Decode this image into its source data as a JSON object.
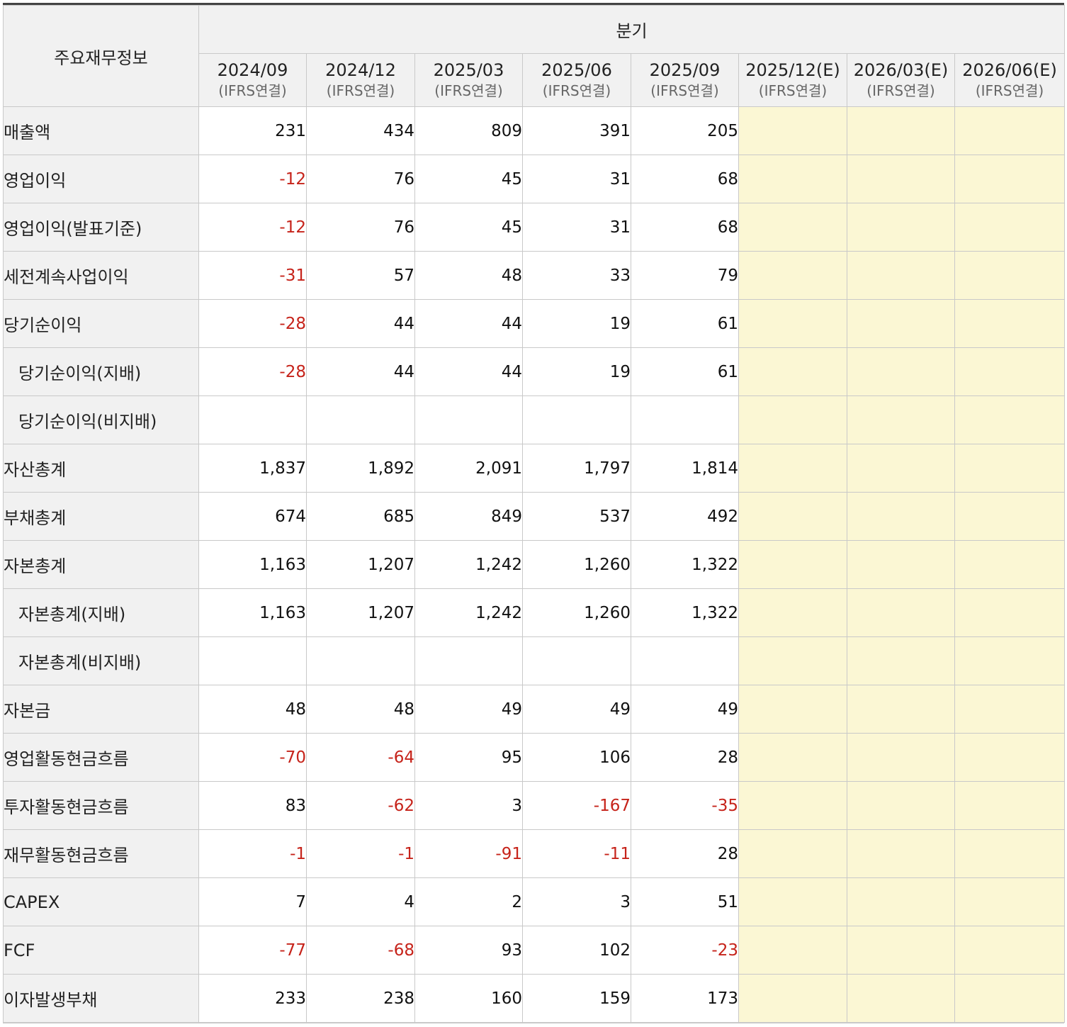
{
  "table": {
    "corner_label": "주요재무정보",
    "group_label": "분기",
    "periods": [
      {
        "period": "2024/09",
        "basis": "(IFRS연결)"
      },
      {
        "period": "2024/12",
        "basis": "(IFRS연결)"
      },
      {
        "period": "2025/03",
        "basis": "(IFRS연결)"
      },
      {
        "period": "2025/06",
        "basis": "(IFRS연결)"
      },
      {
        "period": "2025/09",
        "basis": "(IFRS연결)"
      },
      {
        "period": "2025/12(E)",
        "basis": "(IFRS연결)"
      },
      {
        "period": "2026/03(E)",
        "basis": "(IFRS연결)"
      },
      {
        "period": "2026/06(E)",
        "basis": "(IFRS연결)"
      }
    ],
    "rows": [
      {
        "label": "매출액",
        "sub": false,
        "values": [
          "231",
          "434",
          "809",
          "391",
          "205",
          "",
          "",
          ""
        ]
      },
      {
        "label": "영업이익",
        "sub": false,
        "values": [
          "-12",
          "76",
          "45",
          "31",
          "68",
          "",
          "",
          ""
        ]
      },
      {
        "label": "영업이익(발표기준)",
        "sub": false,
        "values": [
          "-12",
          "76",
          "45",
          "31",
          "68",
          "",
          "",
          ""
        ]
      },
      {
        "label": "세전계속사업이익",
        "sub": false,
        "values": [
          "-31",
          "57",
          "48",
          "33",
          "79",
          "",
          "",
          ""
        ]
      },
      {
        "label": "당기순이익",
        "sub": false,
        "values": [
          "-28",
          "44",
          "44",
          "19",
          "61",
          "",
          "",
          ""
        ]
      },
      {
        "label": "당기순이익(지배)",
        "sub": true,
        "values": [
          "-28",
          "44",
          "44",
          "19",
          "61",
          "",
          "",
          ""
        ]
      },
      {
        "label": "당기순이익(비지배)",
        "sub": true,
        "values": [
          "",
          "",
          "",
          "",
          "",
          "",
          "",
          ""
        ]
      },
      {
        "label": "자산총계",
        "sub": false,
        "values": [
          "1,837",
          "1,892",
          "2,091",
          "1,797",
          "1,814",
          "",
          "",
          ""
        ]
      },
      {
        "label": "부채총계",
        "sub": false,
        "values": [
          "674",
          "685",
          "849",
          "537",
          "492",
          "",
          "",
          ""
        ]
      },
      {
        "label": "자본총계",
        "sub": false,
        "values": [
          "1,163",
          "1,207",
          "1,242",
          "1,260",
          "1,322",
          "",
          "",
          ""
        ]
      },
      {
        "label": "자본총계(지배)",
        "sub": true,
        "values": [
          "1,163",
          "1,207",
          "1,242",
          "1,260",
          "1,322",
          "",
          "",
          ""
        ]
      },
      {
        "label": "자본총계(비지배)",
        "sub": true,
        "values": [
          "",
          "",
          "",
          "",
          "",
          "",
          "",
          ""
        ]
      },
      {
        "label": "자본금",
        "sub": false,
        "values": [
          "48",
          "48",
          "49",
          "49",
          "49",
          "",
          "",
          ""
        ]
      },
      {
        "label": "영업활동현금흐름",
        "sub": false,
        "values": [
          "-70",
          "-64",
          "95",
          "106",
          "28",
          "",
          "",
          ""
        ]
      },
      {
        "label": "투자활동현금흐름",
        "sub": false,
        "values": [
          "83",
          "-62",
          "3",
          "-167",
          "-35",
          "",
          "",
          ""
        ]
      },
      {
        "label": "재무활동현금흐름",
        "sub": false,
        "values": [
          "-1",
          "-1",
          "-91",
          "-11",
          "28",
          "",
          "",
          ""
        ]
      },
      {
        "label": "CAPEX",
        "sub": false,
        "values": [
          "7",
          "4",
          "2",
          "3",
          "51",
          "",
          "",
          ""
        ]
      },
      {
        "label": "FCF",
        "sub": false,
        "values": [
          "-77",
          "-68",
          "93",
          "102",
          "-23",
          "",
          "",
          ""
        ]
      },
      {
        "label": "이자발생부채",
        "sub": false,
        "values": [
          "233",
          "238",
          "160",
          "159",
          "173",
          "",
          "",
          ""
        ]
      }
    ]
  },
  "colors": {
    "negative": "#c6231a",
    "estimate_fill": "#fbf7d4",
    "header_fill": "#f1f1f1"
  }
}
